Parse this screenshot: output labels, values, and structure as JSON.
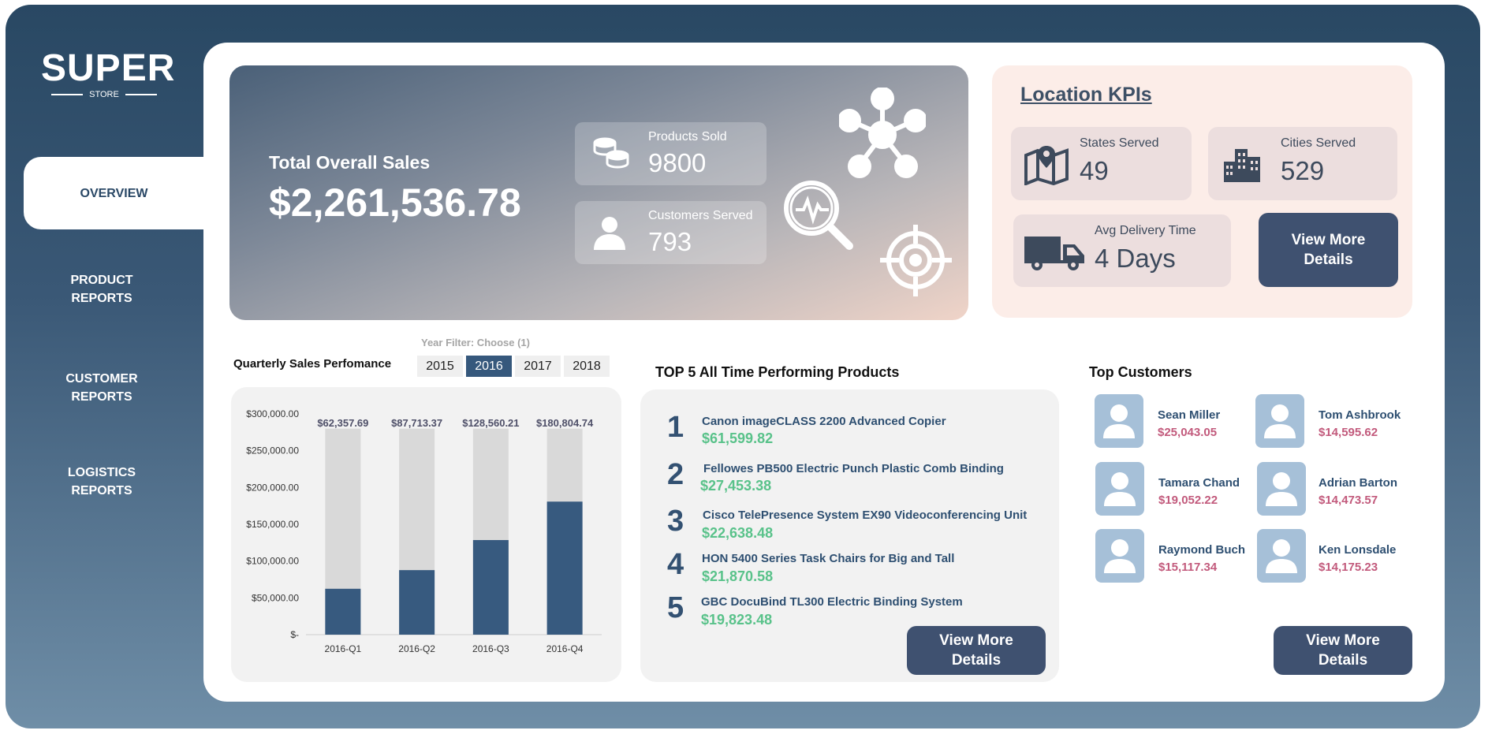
{
  "logo": {
    "mark": "SUPER",
    "sub": "STORE"
  },
  "nav": {
    "overview": "OVERVIEW",
    "product_reports": [
      "PRODUCT",
      "REPORTS"
    ],
    "customer_reports": [
      "CUSTOMER",
      "REPORTS"
    ],
    "logistics_reports": [
      "LOGISTICS",
      "REPORTS"
    ]
  },
  "hero": {
    "label": "Total Overall Sales",
    "value": "$2,261,536.78",
    "products_sold_label": "Products Sold",
    "products_sold_value": "9800",
    "customers_served_label": "Customers Served",
    "customers_served_value": "793"
  },
  "location_kpis": {
    "title": "Location KPIs",
    "states_label": "States Served",
    "states_value": "49",
    "cities_label": "Cities Served",
    "cities_value": "529",
    "delivery_label": "Avg Delivery Time",
    "delivery_value": "4 Days",
    "button": [
      "View More",
      "Details"
    ]
  },
  "quarterly": {
    "title": "Quarterly Sales Perfomance",
    "filter_label": "Year Filter: Choose (1)",
    "years": [
      "2015",
      "2016",
      "2017",
      "2018"
    ],
    "selected_year": "2016"
  },
  "chart_data": {
    "type": "bar",
    "title": "",
    "categories": [
      "2016-Q1",
      "2016-Q2",
      "2016-Q3",
      "2016-Q4"
    ],
    "series": [
      {
        "values": [
          62357.69,
          87713.37,
          128560.21,
          180804.74
        ]
      }
    ],
    "data_labels": [
      "$62,357.69",
      "$87,713.37",
      "$128,560.21",
      "$180,804.74"
    ],
    "background_bar_value": 280000,
    "y_ticks": [
      0,
      50000,
      100000,
      150000,
      200000,
      250000,
      300000
    ],
    "y_tick_labels": [
      "$-",
      "$50,000.00",
      "$100,000.00",
      "$150,000.00",
      "$200,000.00",
      "$250,000.00",
      "$300,000.00"
    ],
    "ylim": [
      0,
      300000
    ],
    "xlabel": "",
    "ylabel": "",
    "colors": {
      "value": "#375a7f",
      "background": "#d9d9d9"
    },
    "grid": false
  },
  "top_products": {
    "title": "TOP 5 All Time Performing Products",
    "items": [
      {
        "rank": "1",
        "name": "Canon imageCLASS 2200 Advanced Copier",
        "value": "$61,599.82"
      },
      {
        "rank": "2",
        "name": "Fellowes PB500 Electric Punch Plastic Comb Binding",
        "value": "$27,453.38"
      },
      {
        "rank": "3",
        "name": "Cisco TelePresence System EX90 Videoconferencing Unit",
        "value": "$22,638.48"
      },
      {
        "rank": "4",
        "name": "HON 5400 Series Task Chairs for Big and Tall",
        "value": "$21,870.58"
      },
      {
        "rank": "5",
        "name": "GBC DocuBind TL300 Electric Binding System",
        "value": "$19,823.48"
      }
    ],
    "button": [
      "View More",
      "Details"
    ]
  },
  "top_customers": {
    "title": "Top Customers",
    "items": [
      {
        "name": "Sean Miller",
        "value": "$25,043.05"
      },
      {
        "name": "Tom Ashbrook",
        "value": "$14,595.62"
      },
      {
        "name": "Tamara Chand",
        "value": "$19,052.22"
      },
      {
        "name": "Adrian Barton",
        "value": "$14,473.57"
      },
      {
        "name": "Raymond Buch",
        "value": "$15,117.34"
      },
      {
        "name": "Ken Lonsdale",
        "value": "$14,175.23"
      }
    ],
    "button": [
      "View More",
      "Details"
    ]
  },
  "colors": {
    "sidebar_top": "#294863",
    "sidebar_bottom": "#6f8ea7",
    "accent_dark": "#3f5170",
    "value_green": "#59c28a",
    "customer_value": "#c25a7c",
    "kpi_panel": "#fcede8"
  },
  "icons": [
    "coins-icon",
    "user-icon",
    "network-icon",
    "analytics-magnifier-icon",
    "target-icon",
    "map-icon",
    "buildings-icon",
    "truck-icon",
    "customer-avatar-icon"
  ]
}
